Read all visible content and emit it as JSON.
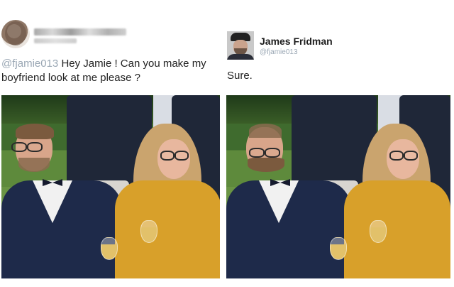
{
  "left_tweet": {
    "mention": "@fjamie013",
    "message": " Hey Jamie ! Can you make my boyfriend look at me please ?"
  },
  "right_tweet": {
    "display_name": "James Fridman",
    "handle": "@fjamie013",
    "reply": "Sure."
  },
  "colors": {
    "mention": "#9aa7b4",
    "text": "#222222"
  }
}
